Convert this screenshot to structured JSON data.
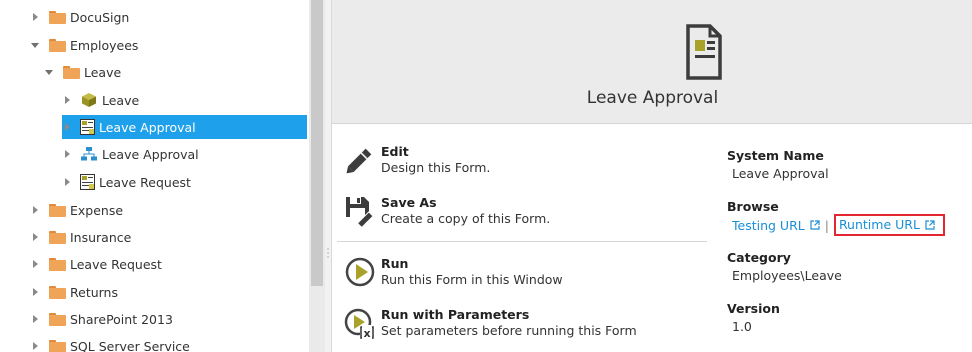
{
  "tree": {
    "items": [
      {
        "label": "DocuSign",
        "icon": "folder-icon",
        "expanded": false
      },
      {
        "label": "Employees",
        "icon": "folder-icon",
        "expanded": true
      },
      {
        "label": "Leave",
        "icon": "folder-icon",
        "expanded": true
      },
      {
        "label": "Leave",
        "icon": "smartobject-icon",
        "expanded": false
      },
      {
        "label": "Leave Approval",
        "icon": "form-icon",
        "expanded": false,
        "selected": true
      },
      {
        "label": "Leave Approval",
        "icon": "workflow-icon",
        "expanded": false
      },
      {
        "label": "Leave Request",
        "icon": "form-icon",
        "expanded": false
      },
      {
        "label": "Expense",
        "icon": "folder-icon",
        "expanded": false
      },
      {
        "label": "Insurance",
        "icon": "folder-icon",
        "expanded": false
      },
      {
        "label": "Leave Request",
        "icon": "folder-icon",
        "expanded": false
      },
      {
        "label": "Returns",
        "icon": "folder-icon",
        "expanded": false
      },
      {
        "label": "SharePoint 2013",
        "icon": "folder-icon",
        "expanded": false
      },
      {
        "label": "SQL Server Service",
        "icon": "folder-icon",
        "expanded": false
      }
    ]
  },
  "header": {
    "title": "Leave Approval",
    "icon": "form-document-icon"
  },
  "actions": [
    {
      "title": "Edit",
      "description": "Design this Form.",
      "icon": "pencil-icon"
    },
    {
      "title": "Save As",
      "description": "Create a copy of this Form.",
      "icon": "save-as-icon"
    },
    {
      "title": "Run",
      "description": "Run this Form in this Window",
      "icon": "run-icon"
    },
    {
      "title": "Run with Parameters",
      "description": "Set parameters before running this Form",
      "icon": "run-with-parameters-icon"
    }
  ],
  "properties": {
    "system_name_label": "System Name",
    "system_name_value": "Leave Approval",
    "browse_label": "Browse",
    "testing_url_label": "Testing URL",
    "link_separator": "|",
    "runtime_url_label": "Runtime URL",
    "category_label": "Category",
    "category_value": "Employees\\Leave",
    "version_label": "Version",
    "version_value": "1.0"
  },
  "colors": {
    "selection": "#1fa0ea",
    "link": "#1a8fd6",
    "highlight_border": "#e3262f",
    "folder": "#f0a457",
    "run_icon": "#a9a22a"
  }
}
